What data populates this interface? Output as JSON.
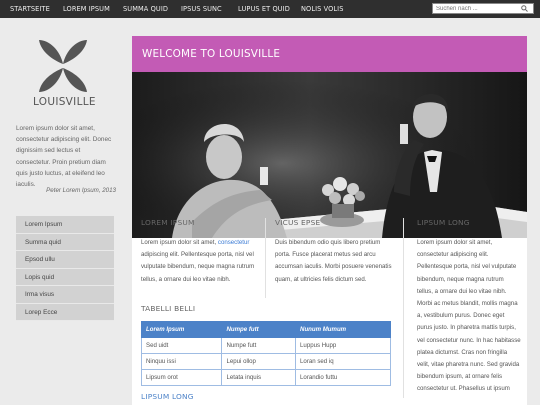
{
  "nav": {
    "items": [
      "STARTSEITE",
      "LOREM IPSUM",
      "SUMMA QUID",
      "IPSUS SUNC",
      "LUPUS ET QUID",
      "NOLIS VOLIS"
    ],
    "search_placeholder": "Suchen nach ..."
  },
  "sidebar": {
    "logo_text": "LOUISVILLE",
    "intro": "Lorem ipsum dolor sit amet, consectetur adipiscing elit. Donec dignissim sed lectus et consectetur. Proin pretium diam quis justo luctus, at eleifend leo iaculis.",
    "quote": "Peter Lorem Ipsum, 2013",
    "menu": [
      "Lorem Ipsum",
      "Summa quid",
      "Epsod ullu",
      "Lopis quid",
      "Irma visus",
      "Lorep Ecce"
    ]
  },
  "main": {
    "welcome": "WELCOME TO LOUISVILLE",
    "col1": {
      "title": "LOREM IPSUM",
      "text_before": "Lorem ipsum dolor sit amet, ",
      "link": "consectetur",
      "text_after": " adipiscing elit. Pellentesque porta, nisl vel vulputate bibendum, neque magna rutrum tellus, a ornare dui leo vitae nibh."
    },
    "col2": {
      "title": "VICUS EPSE",
      "text": "Duis bibendum odio quis libero pretium porta. Fusce placerat metus sed arcu accumsan iaculis. Morbi posuere venenatis quam, at ultricies felis dictum sed."
    },
    "col3": {
      "title": "LIPSUM LONG",
      "text": "Lorem ipsum dolor sit amet, consectetur adipiscing elit. Pellentesque porta, nisl vel vulputate bibendum, neque magna rutrum tellus, a ornare dui leo vitae nibh. Morbi ac metus blandit, mollis magna a, vestibulum purus. Donec eget purus justo. In pharetra mattis turpis, vel consectetur nunc. In hac habitasse platea dictumst. Cras non fringilla velit, vitae pharetra nunc. Sed gravida bibendum ipsum, at ornare felis consectetur ut. Phasellus ut ipsum"
    },
    "table": {
      "title": "TABELLI BELLI",
      "headers": [
        "Lorem Ipsum",
        "Numpe futt",
        "Nunum Mumum"
      ],
      "rows": [
        [
          "Sed uidt",
          "Numpe futt",
          "Luppus Hupp"
        ],
        [
          "Ninquu issi",
          "Lepui ollop",
          "Loran sed iq"
        ],
        [
          "Lipsum orot",
          "Letata inquis",
          "Lorandio futtu"
        ]
      ]
    },
    "bottom_title": "LIPSUM LONG"
  }
}
